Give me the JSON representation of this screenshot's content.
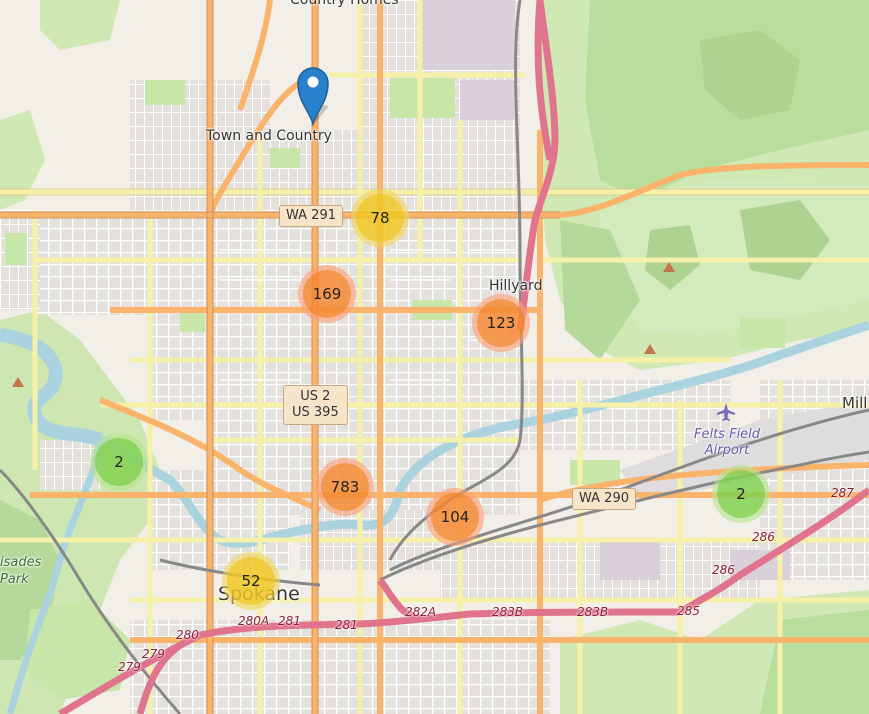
{
  "map": {
    "places": {
      "country_homes": "Country Homes",
      "town_and_country": "Town and Country",
      "hillyard": "Hillyard",
      "spokane": "Spokane",
      "felts_field_airport": "Felts Field\nAirport",
      "mill": "Mill",
      "palisades_park": "isades\nPark"
    },
    "shields": {
      "wa291": "WA 291",
      "us2_line1": "US 2",
      "us2_line2": "US 395",
      "wa290": "WA 290"
    },
    "exits": {
      "e280": "280",
      "e280a": "280A",
      "e281a": "281",
      "e281b": "281",
      "e282a": "282A",
      "e283b": "283B",
      "e283b2": "283B",
      "e285": "285",
      "e286a": "286",
      "e286b": "286",
      "e287": "287",
      "e279a": "279",
      "e279b": "279"
    },
    "clusters": [
      {
        "id": "wa291",
        "count": "78",
        "size": "medium"
      },
      {
        "id": "north-central",
        "count": "169",
        "size": "large"
      },
      {
        "id": "hillyard",
        "count": "123",
        "size": "large"
      },
      {
        "id": "west",
        "count": "2",
        "size": "small"
      },
      {
        "id": "central",
        "count": "783",
        "size": "large"
      },
      {
        "id": "east-central",
        "count": "104",
        "size": "large"
      },
      {
        "id": "felts",
        "count": "2",
        "size": "small"
      },
      {
        "id": "downtown",
        "count": "52",
        "size": "medium"
      }
    ],
    "colors": {
      "land": "#f2efe9",
      "park": "#c8e6a8",
      "forest": "#add19e",
      "water": "#aad3df",
      "major_road": "#f9b36b",
      "secondary_road": "#f6f1a8",
      "motorway": "#e0748d",
      "marker": "#2a81cb"
    }
  }
}
